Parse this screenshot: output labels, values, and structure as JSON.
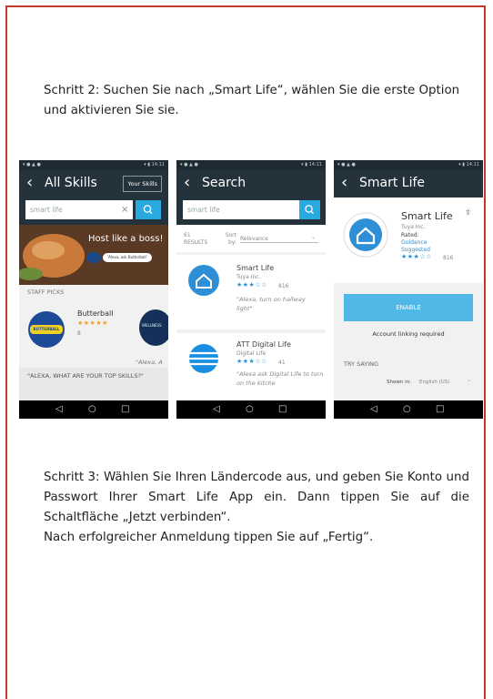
{
  "step2": {
    "text": "Schritt 2: Suchen Sie nach „Smart Life“, wählen Sie die erste Option und aktivieren Sie sie."
  },
  "step3": {
    "lines": [
      "Schritt 3: Wählen Sie Ihren Ländercode aus, und geben Sie Konto und Passwort Ihrer Smart Life App ein. Dann tippen Sie auf die Schaltfläche „Jetzt verbinden“.",
      "Nach erfolgreicher Anmeldung tippen Sie auf „Fertig“."
    ]
  },
  "phone1": {
    "title": "All Skills",
    "your_skills": "Your Skills",
    "search_value": "smart life",
    "banner_text": "Host like a boss!",
    "banner_pill": "'Alexa, ask Butterball'",
    "section": "STAFF PICKS",
    "skill_name": "Butterball",
    "skill_logo": "BUTTERBALL",
    "skill_count": "8",
    "second_logo": "WELLNESS",
    "quote_partial": "\"Alexa, A",
    "bottom_text": "\"ALEXA, WHAT ARE YOUR TOP SKILLS?\""
  },
  "phone2": {
    "title": "Search",
    "search_value": "smart life",
    "results_count": "61",
    "results_label": "RESULTS",
    "sort_label": "Sort by:",
    "sort_value": "Relevance",
    "items": [
      {
        "name": "Smart Life",
        "vendor": "Tuya Inc.",
        "count": "816",
        "quote": "\"Alexa, turn on hallway light\""
      },
      {
        "name": "ATT Digital Life",
        "vendor": "Digital Life",
        "count": "41",
        "quote": "\"Alexa ask Digital Life to turn on the kitche"
      }
    ]
  },
  "phone3": {
    "title": "Smart Life",
    "name": "Smart Life",
    "vendor": "Tuya Inc.",
    "rated": "Rated:",
    "rating_1": "Guidance",
    "rating_2": "Suggested",
    "count": "816",
    "enable": "ENABLE",
    "account_linking": "Account linking required",
    "try_saying": "TRY SAYING",
    "shown_in_label": "Shown in:",
    "shown_in_value": "English (US)"
  },
  "icons": {
    "back": "‹",
    "search": "search-icon",
    "clear": "×",
    "nav_back": "◁",
    "nav_home": "○",
    "nav_recent": "□",
    "share": "share-icon"
  },
  "colors": {
    "frame": "#c0392b",
    "appbar": "#24323b",
    "accent": "#28a9e0",
    "star": "#2b8fd6"
  }
}
